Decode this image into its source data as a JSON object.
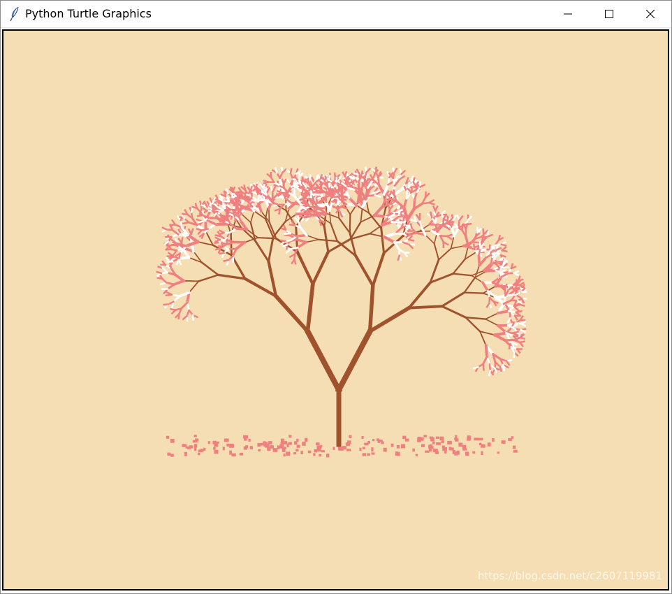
{
  "window": {
    "title": "Python Turtle Graphics",
    "app_icon": "feather-icon",
    "controls": {
      "minimize": "minimize-icon",
      "maximize": "maximize-icon",
      "close": "close-icon"
    }
  },
  "canvas": {
    "background_color": "#f5deb3",
    "branch_color": "#a0522d",
    "blossom_colors": [
      "#f08080",
      "#ffffff"
    ]
  },
  "watermark": "https://blog.csdn.net/c2607119981"
}
